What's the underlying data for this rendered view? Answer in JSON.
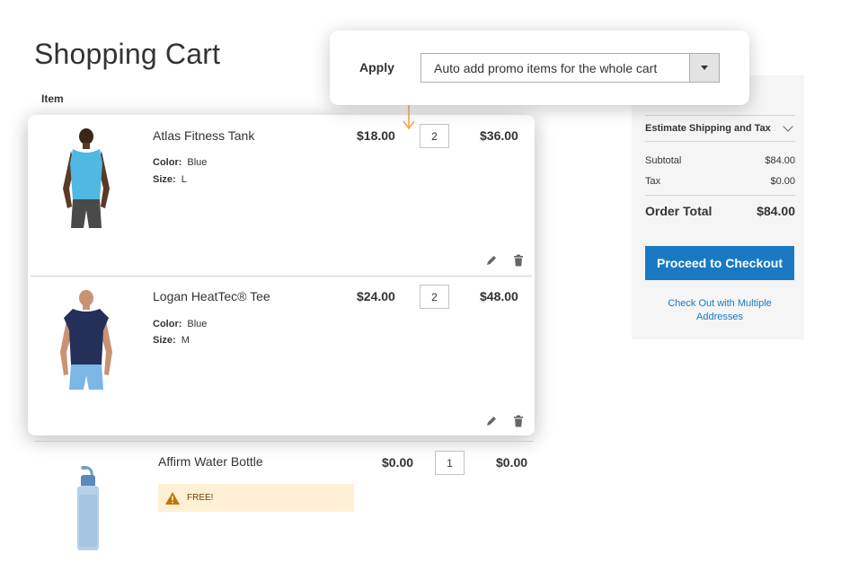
{
  "page": {
    "title": "Shopping Cart",
    "item_header": "Item"
  },
  "apply": {
    "label": "Apply",
    "selected": "Auto add promo items for the whole cart"
  },
  "cart": {
    "items": [
      {
        "name": "Atlas Fitness Tank",
        "color_label": "Color:",
        "color": "Blue",
        "size_label": "Size:",
        "size": "L",
        "price": "$18.00",
        "qty": "2",
        "subtotal": "$36.00"
      },
      {
        "name": "Logan HeatTec® Tee",
        "color_label": "Color:",
        "color": "Blue",
        "size_label": "Size:",
        "size": "M",
        "price": "$24.00",
        "qty": "2",
        "subtotal": "$48.00"
      },
      {
        "name": "Affirm Water Bottle",
        "price": "$0.00",
        "qty": "1",
        "subtotal": "$0.00",
        "badge": "FREE!"
      }
    ]
  },
  "summary": {
    "estimate": "Estimate Shipping and Tax",
    "subtotal_label": "Subtotal",
    "subtotal": "$84.00",
    "tax_label": "Tax",
    "tax": "$0.00",
    "total_label": "Order Total",
    "total": "$84.00",
    "checkout": "Proceed to Checkout",
    "multi": "Check Out with Multiple Addresses"
  },
  "colors": {
    "accent": "#1979c3",
    "connector": "#f0a446",
    "warning_bg": "#fdf0d5"
  },
  "icons": {
    "edit": "pencil-icon",
    "delete": "trash-icon",
    "warning": "warning-icon",
    "dropdown": "caret-down-icon"
  }
}
